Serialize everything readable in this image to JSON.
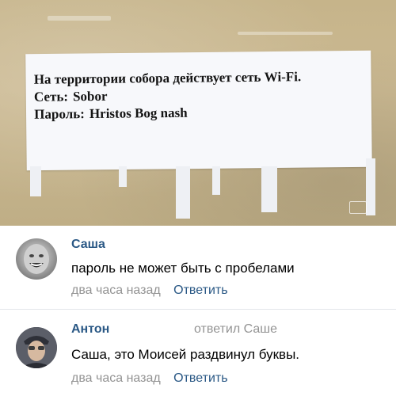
{
  "photo": {
    "notice_lines": [
      "На территории собора действует сеть Wi-Fi.",
      "Сеть:",
      "Sobor",
      "Пароль:",
      "Hristos Bog nash"
    ]
  },
  "comments": [
    {
      "author": "Саша",
      "text": "пароль не может быть с пробелами",
      "time": "два часа назад",
      "reply_label": "Ответить"
    },
    {
      "author": "Антон",
      "reply_to": "ответил Саше",
      "text": "Саша, это Моисей раздвинул буквы.",
      "time": "два часа назад",
      "reply_label": "Ответить"
    }
  ],
  "colors": {
    "link": "#2a5885",
    "muted": "#939393",
    "wall": "#c6b48a",
    "paper": "#f7f8fb"
  }
}
